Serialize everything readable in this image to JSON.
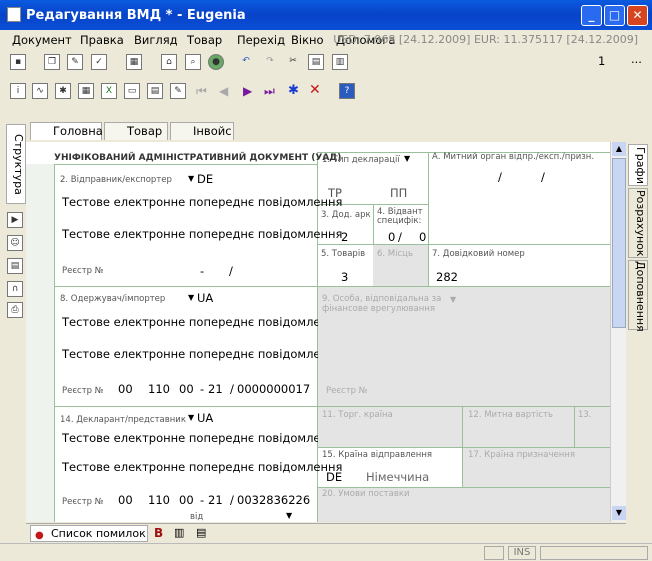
{
  "window": {
    "title": "Редагування ВМД * - Eugenia"
  },
  "menu": [
    "Документ",
    "Правка",
    "Вигляд",
    "Товар",
    "Перехід",
    "Вікно",
    "Допомога"
  ],
  "rates": "USD: 7.968 [24.12.2009] EUR: 11.375117 [24.12.2009]",
  "toolbar": {
    "counter": "1",
    "ellipsis": "..."
  },
  "tabs": {
    "main": "Головна",
    "goods": "Товар",
    "invoice": "Інвойс"
  },
  "side_left": {
    "structure": "Структура"
  },
  "side_right": {
    "graphs": "Графи",
    "calc": "Розрахунок",
    "extra": "Доповнення"
  },
  "form": {
    "header": "УНІФІКОВАНИЙ АДМІНІСТРАТИВНИЙ ДОКУМЕНТ (УАД)",
    "g1": "1. Тип декларації",
    "g1a": "ТР",
    "g1b": "ПП",
    "gA": "А. Митний орган відпр./експ./призн.",
    "slash": "/",
    "g2": "2. Відправник/експортер",
    "g2c": "DE",
    "g2t1": "Тестове електронне попереднє повідомлення",
    "g2t2": "Тестове електронне попереднє повідомлення",
    "reg": "Реєстр №",
    "dash": "-",
    "g3": "3. Дод. арк",
    "g3v": "2",
    "g4": "4. Відвант специфік:",
    "g4a": "0",
    "g4b": "0",
    "g5": "5. Товарів",
    "g5v": "3",
    "g6": "6. Місць",
    "g7": "7. Довідковий номер",
    "g7v": "282",
    "g8": "8. Одержувач/імпортер",
    "g8c": "UA",
    "g8t1": "Тестове електронне попереднє повідомлення",
    "g8t2": "Тестове електронне попереднє повідомлення",
    "g8r": [
      "00",
      "110",
      "00",
      "21",
      "0000000017"
    ],
    "g9": "9. Особа, відповідальна за фінансове врегулювання",
    "g14": "14. Декларант/представник",
    "g14c": "UA",
    "g14t1": "Тестове електронне попереднє повідомлення",
    "g14t2": "Тестове електронне попереднє повідомлення",
    "g14r": [
      "00",
      "110",
      "00",
      "21",
      "0032836226"
    ],
    "vid": "від",
    "g11": "11. Торг. країна",
    "g12": "12. Митна вартість",
    "g13": "13.",
    "g15": "15. Країна відправлення",
    "g15c": "DE",
    "g15n": "Німеччина",
    "g17": "17. Країна призначення",
    "g20": "20. Умови поставки"
  },
  "bottom": {
    "errors": "Список помилок"
  },
  "status": {
    "ins": "INS"
  }
}
